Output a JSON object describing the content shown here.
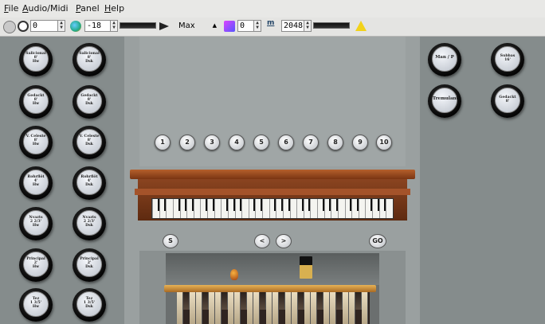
{
  "menu": [
    {
      "underline": "F",
      "rest": "ile"
    },
    {
      "underline": "A",
      "rest": "udio/Midi"
    },
    {
      "underline": "P",
      "rest": "anel"
    },
    {
      "underline": "H",
      "rest": "elp"
    }
  ],
  "toolbar": {
    "transpose_value": "0",
    "volume_value": "-18",
    "polyphony_label": "Max",
    "tuning_value": "0",
    "samples_label": "m",
    "samples_value": "2048",
    "warning_icon": "warning-icon",
    "accent": "#f2d21a"
  },
  "left_stops": [
    [
      "Salicional\n8'\nHw",
      "Salicional\n8'\nDsk"
    ],
    [
      "Gedackt\n8'\nHw",
      "Gedackt\n8'\nDsk"
    ],
    [
      "V. Celeste\n8'\nHw",
      "V. Celeste\n8'\nDsk"
    ],
    [
      "Rohrflöt\n4'\nHw",
      "Rohrflöt\n4'\nDsk"
    ],
    [
      "Nvazts\n2 2/3'\nHw",
      "Nvazts\n2 2/3'\nDsk"
    ],
    [
      "Principal\n2'\nHw",
      "Principal\n2'\nDsk"
    ],
    [
      "Tez\n1 3/5'\nHw",
      "Tez\n1 3/5'\nDsk"
    ]
  ],
  "right_stops": [
    [
      "Man / P",
      "Subbas\n16'"
    ],
    [
      "Tremulant",
      "Gedackt\n8'"
    ]
  ],
  "pistons": [
    "1",
    "2",
    "3",
    "4",
    "5",
    "6",
    "7",
    "8",
    "9",
    "10"
  ],
  "controls": {
    "set_label": "S",
    "prev_label": "<",
    "next_label": ">",
    "go_label": "GO"
  }
}
